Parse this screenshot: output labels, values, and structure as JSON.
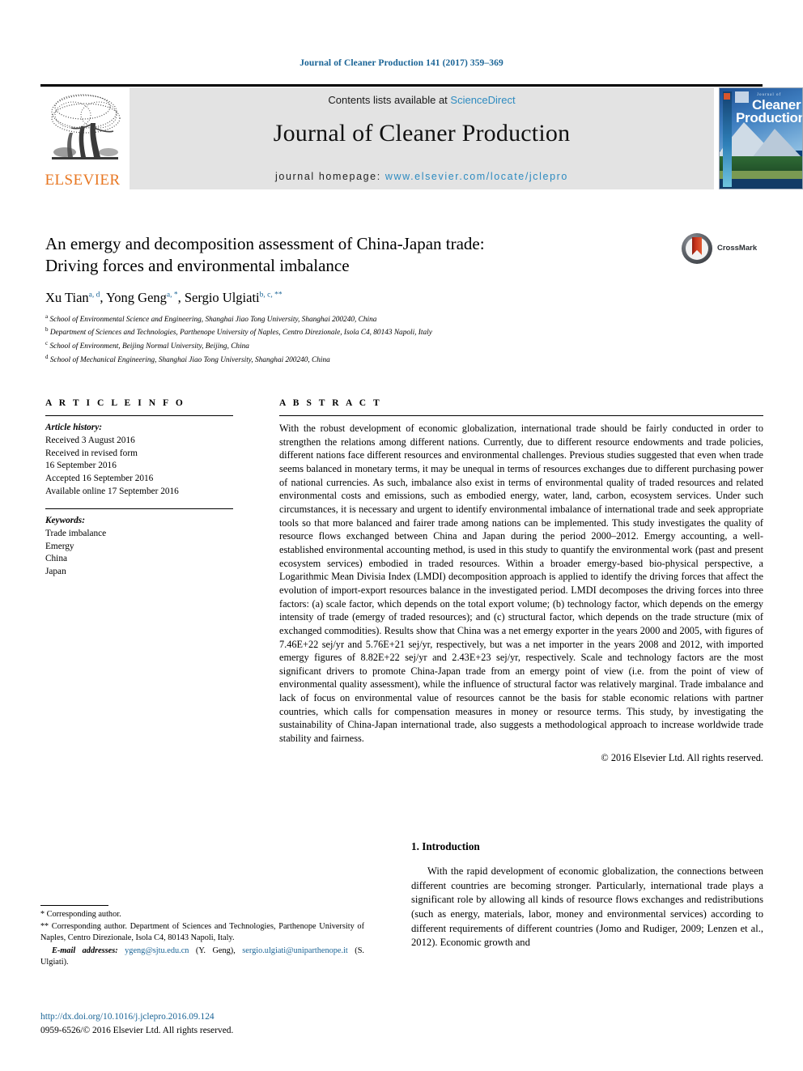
{
  "running_head": "Journal of Cleaner Production 141 (2017) 359–369",
  "masthead": {
    "contents_prefix": "Contents lists available at ",
    "sciencedirect": "ScienceDirect",
    "journal_title": "Journal of Cleaner Production",
    "homepage_label": "journal homepage: ",
    "homepage_url": "www.elsevier.com/locate/jclepro",
    "publisher": "ELSEVIER",
    "cover": {
      "journal_of": "Journal of",
      "line1": "Cleaner",
      "line2": "Production"
    }
  },
  "crossmark": {
    "label": "CrossMark"
  },
  "article": {
    "title_line1": "An emergy and decomposition assessment of China-Japan trade:",
    "title_line2": "Driving forces and environmental imbalance",
    "authors": [
      {
        "name": "Xu Tian",
        "sup": "a, d"
      },
      {
        "name": "Yong Geng",
        "sup": "a, *"
      },
      {
        "name": "Sergio Ulgiati",
        "sup": "b, c, **"
      }
    ],
    "affiliations": [
      {
        "marker": "a",
        "text": "School of Environmental Science and Engineering, Shanghai Jiao Tong University, Shanghai 200240, China"
      },
      {
        "marker": "b",
        "text": "Department of Sciences and Technologies, Parthenope University of Naples, Centro Direzionale, Isola C4, 80143 Napoli, Italy"
      },
      {
        "marker": "c",
        "text": "School of Environment, Beijing Normal University, Beijing, China"
      },
      {
        "marker": "d",
        "text": "School of Mechanical Engineering, Shanghai Jiao Tong University, Shanghai 200240, China"
      }
    ]
  },
  "article_info": {
    "heading": "A R T I C L E  I N F O",
    "history_label": "Article history:",
    "history": [
      "Received 3 August 2016",
      "Received in revised form",
      "16 September 2016",
      "Accepted 16 September 2016",
      "Available online 17 September 2016"
    ],
    "keywords_label": "Keywords:",
    "keywords": [
      "Trade imbalance",
      "Emergy",
      "China",
      "Japan"
    ]
  },
  "abstract": {
    "heading": "A B S T R A C T",
    "text": "With the robust development of economic globalization, international trade should be fairly conducted in order to strengthen the relations among different nations. Currently, due to different resource endowments and trade policies, different nations face different resources and environmental challenges. Previous studies suggested that even when trade seems balanced in monetary terms, it may be unequal in terms of resources exchanges due to different purchasing power of national currencies. As such, imbalance also exist in terms of environmental quality of traded resources and related environmental costs and emissions, such as embodied energy, water, land, carbon, ecosystem services. Under such circumstances, it is necessary and urgent to identify environmental imbalance of international trade and seek appropriate tools so that more balanced and fairer trade among nations can be implemented. This study investigates the quality of resource flows exchanged between China and Japan during the period 2000–2012. Emergy accounting, a well-established environmental accounting method, is used in this study to quantify the environmental work (past and present ecosystem services) embodied in traded resources. Within a broader emergy-based bio-physical perspective, a Logarithmic Mean Divisia Index (LMDI) decomposition approach is applied to identify the driving forces that affect the evolution of import-export resources balance in the investigated period. LMDI decomposes the driving forces into three factors: (a) scale factor, which depends on the total export volume; (b) technology factor, which depends on the emergy intensity of trade (emergy of traded resources); and (c) structural factor, which depends on the trade structure (mix of exchanged commodities). Results show that China was a net emergy exporter in the years 2000 and 2005, with figures of 7.46E+22 sej/yr and 5.76E+21 sej/yr, respectively, but was a net importer in the years 2008 and 2012, with imported emergy figures of 8.82E+22 sej/yr and 2.43E+23 sej/yr, respectively. Scale and technology factors are the most significant drivers to promote China-Japan trade from an emergy point of view (i.e. from the point of view of environmental quality assessment), while the influence of structural factor was relatively marginal. Trade imbalance and lack of focus on environmental value of resources cannot be the basis for stable economic relations with partner countries, which calls for compensation measures in money or resource terms. This study, by investigating the sustainability of China-Japan international trade, also suggests a methodological approach to increase worldwide trade stability and fairness.",
    "copyright": "© 2016 Elsevier Ltd. All rights reserved."
  },
  "introduction": {
    "heading": "1.  Introduction",
    "text_before_cite": "With the rapid development of economic globalization, the connections between different countries are becoming stronger. Particularly, international trade plays a significant role by allowing all kinds of resource flows exchanges and redistributions (such as energy, materials, labor, money and environmental services) according to different requirements of different countries (",
    "citation": "Jomo and Rudiger, 2009; Lenzen et al., 2012",
    "text_after_cite": "). Economic growth and"
  },
  "footnotes": {
    "line1_marker": "*",
    "line1": "Corresponding author.",
    "line2_marker": "**",
    "line2": "Corresponding author. Department of Sciences and Technologies, Parthenope University of Naples, Centro Direzionale, Isola C4, 80143 Napoli, Italy.",
    "email_label": "E-mail addresses:",
    "email1": "ygeng@sjtu.edu.cn",
    "email1_owner": "(Y. Geng),",
    "email2": "sergio.ulgiati@uniparthenope.it",
    "email2_owner": "(S. Ulgiati)."
  },
  "doi_block": {
    "doi": "http://dx.doi.org/10.1016/j.jclepro.2016.09.124",
    "issn_line": "0959-6526/© 2016 Elsevier Ltd. All rights reserved."
  },
  "colors": {
    "link_blue": "#1a6496",
    "sciencedirect_blue": "#2e8bc0",
    "elsevier_orange": "#E87722"
  }
}
